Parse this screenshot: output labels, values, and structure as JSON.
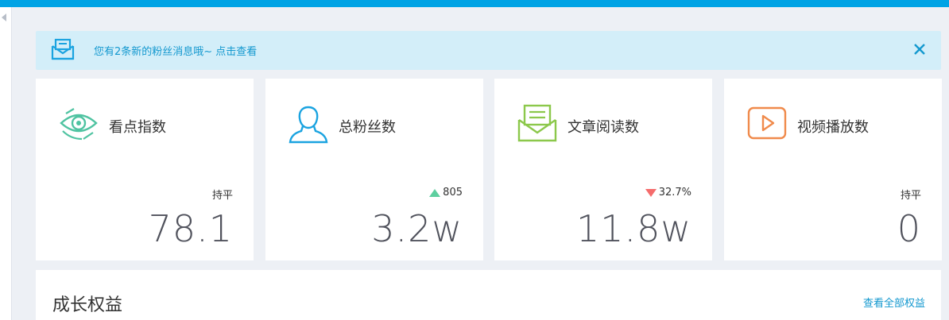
{
  "notice": {
    "message": "您有2条新的粉丝消息哦~ 点击查看",
    "close_icon": "close-icon",
    "mail_icon": "mail-icon"
  },
  "cards": [
    {
      "title": "看点指数",
      "icon": "eye-icon",
      "trend_label": "持平",
      "trend_direction": "flat",
      "value": "78.1"
    },
    {
      "title": "总粉丝数",
      "icon": "user-icon",
      "trend_label": "805",
      "trend_direction": "up",
      "value": "3.2w"
    },
    {
      "title": "文章阅读数",
      "icon": "envelope-icon",
      "trend_label": "32.7%",
      "trend_direction": "down",
      "value": "11.8w"
    },
    {
      "title": "视频播放数",
      "icon": "play-icon",
      "trend_label": "持平",
      "trend_direction": "flat",
      "value": "0"
    }
  ],
  "growth": {
    "title": "成长权益",
    "view_all": "查看全部权益"
  },
  "colors": {
    "topbar": "#00a3e5",
    "accent_link": "#1398cf",
    "up": "#5dcf9f",
    "down": "#f56c6c",
    "eye_icon": "#4fc3a1",
    "user_icon": "#1aa3e0",
    "envelope_icon": "#8cc84b",
    "play_icon": "#f08a4b"
  }
}
